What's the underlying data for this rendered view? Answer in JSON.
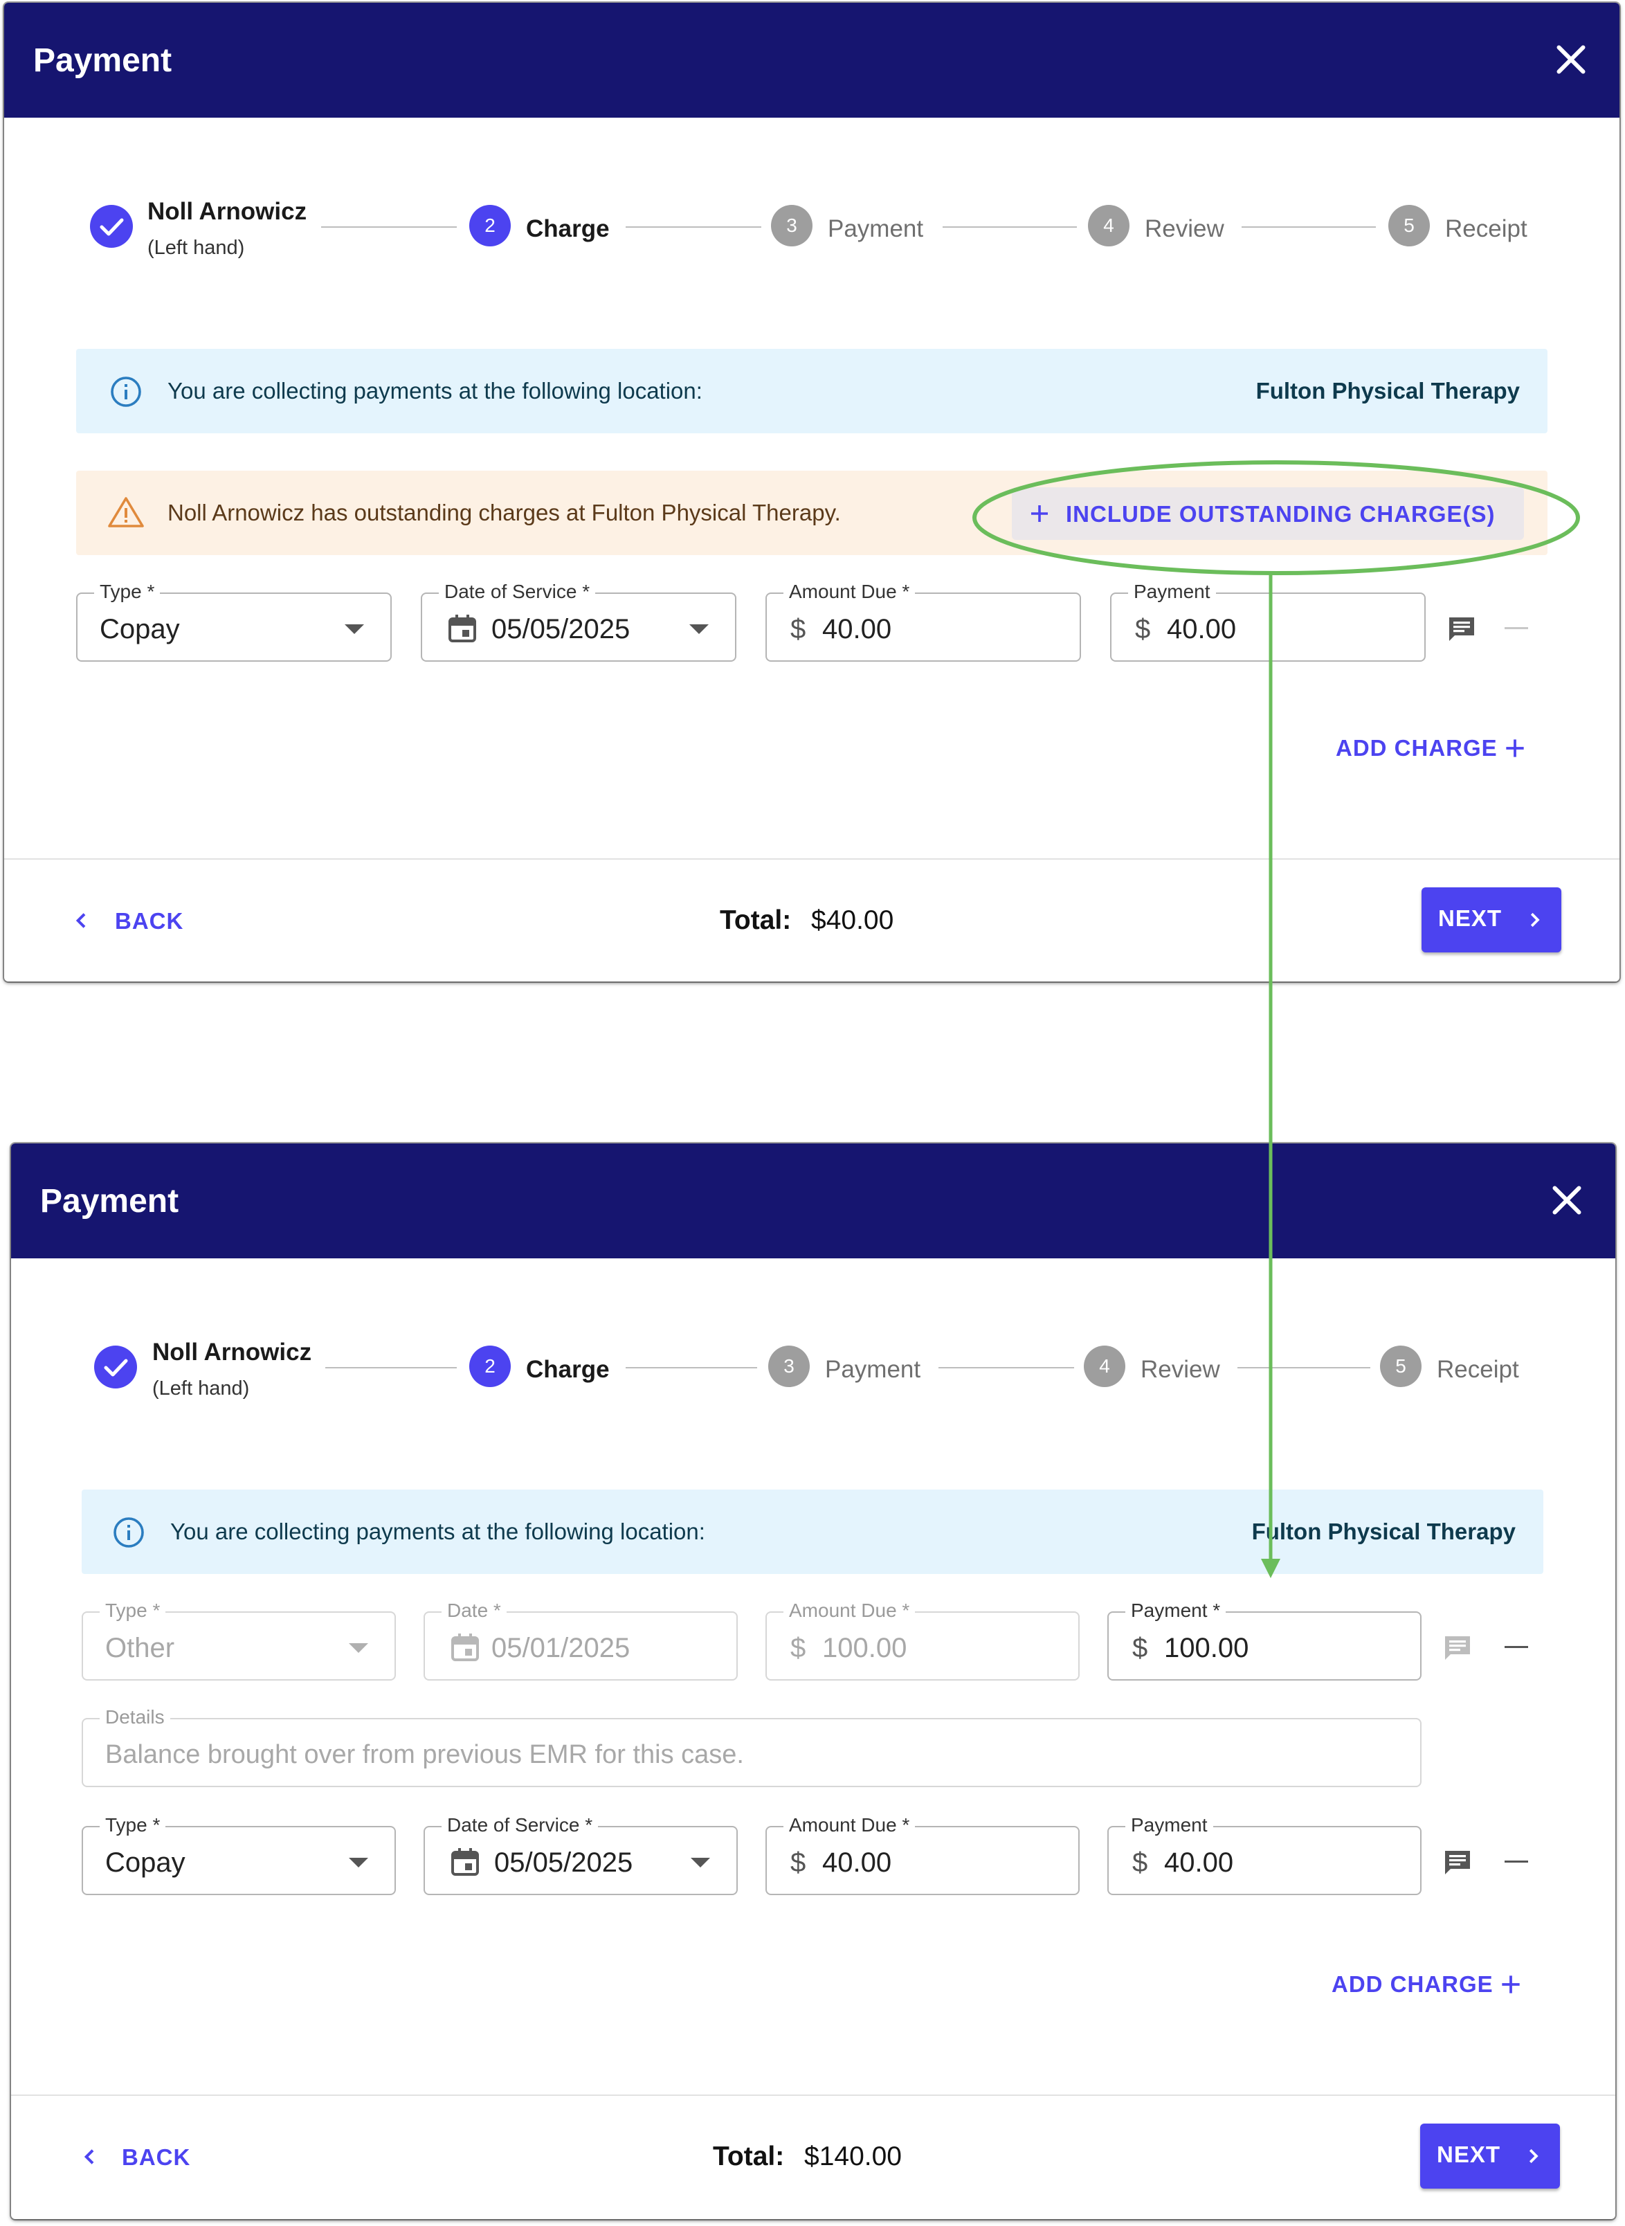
{
  "colors": {
    "header": "#161570",
    "accent": "#4c43f0",
    "info_bg": "#e4f4fd",
    "warn_bg": "#fdf1e4",
    "annotation": "#6bbd5b"
  },
  "before": {
    "title": "Payment",
    "stepper": {
      "patient_name": "Noll Arnowicz",
      "patient_sub": "(Left hand)",
      "steps": [
        {
          "num": "2",
          "label": "Charge"
        },
        {
          "num": "3",
          "label": "Payment"
        },
        {
          "num": "4",
          "label": "Review"
        },
        {
          "num": "5",
          "label": "Receipt"
        }
      ]
    },
    "info": {
      "text": "You are collecting payments at the following location:",
      "location": "Fulton Physical Therapy"
    },
    "warning": {
      "text": "Noll Arnowicz has outstanding charges at Fulton Physical Therapy.",
      "button": "INCLUDE OUTSTANDING CHARGE(S)"
    },
    "charge": {
      "type_label": "Type *",
      "type_value": "Copay",
      "date_label": "Date of Service *",
      "date_value": "05/05/2025",
      "amount_label": "Amount Due *",
      "amount_value": "40.00",
      "payment_label": "Payment",
      "payment_value": "40.00",
      "currency": "$"
    },
    "add_charge": "ADD CHARGE",
    "back": "BACK",
    "total_label": "Total:",
    "total_value": "$40.00",
    "next": "NEXT"
  },
  "after": {
    "title": "Payment",
    "stepper": {
      "patient_name": "Noll Arnowicz",
      "patient_sub": "(Left hand)",
      "steps": [
        {
          "num": "2",
          "label": "Charge"
        },
        {
          "num": "3",
          "label": "Payment"
        },
        {
          "num": "4",
          "label": "Review"
        },
        {
          "num": "5",
          "label": "Receipt"
        }
      ]
    },
    "info": {
      "text": "You are collecting payments at the following location:",
      "location": "Fulton Physical Therapy"
    },
    "outstanding": {
      "type_label": "Type *",
      "type_value": "Other",
      "date_label": "Date *",
      "date_value": "05/01/2025",
      "amount_label": "Amount Due *",
      "amount_value": "100.00",
      "payment_label": "Payment *",
      "payment_value": "100.00",
      "details_label": "Details",
      "details_value": "Balance brought over from previous EMR for this case.",
      "currency": "$"
    },
    "charge": {
      "type_label": "Type *",
      "type_value": "Copay",
      "date_label": "Date of Service *",
      "date_value": "05/05/2025",
      "amount_label": "Amount Due *",
      "amount_value": "40.00",
      "payment_label": "Payment",
      "payment_value": "40.00",
      "currency": "$"
    },
    "add_charge": "ADD CHARGE",
    "back": "BACK",
    "total_label": "Total:",
    "total_value": "$140.00",
    "next": "NEXT"
  }
}
